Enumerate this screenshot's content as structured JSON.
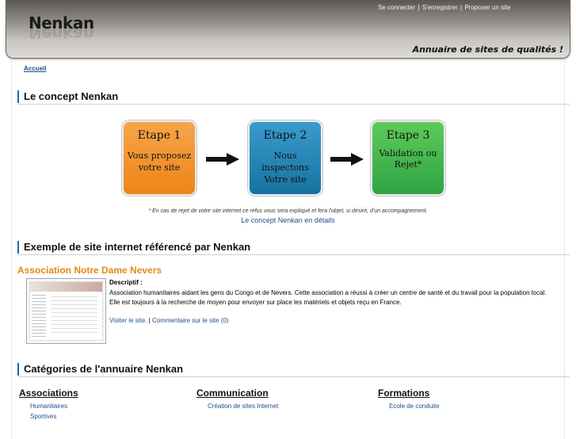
{
  "header": {
    "logo": "Nenkan",
    "tagline": "Annuaire de sites de qualités !",
    "links": {
      "login": "Se connecter",
      "register": "S'enregistrer",
      "propose": "Proposer un site",
      "separator": "|"
    }
  },
  "breadcrumb": {
    "home": "Accueil"
  },
  "concept": {
    "title": "Le concept Nenkan",
    "steps": [
      {
        "title": "Etape 1",
        "description": "Vous proposez votre site",
        "color": "#f08a1e"
      },
      {
        "title": "Etape 2",
        "description": "Nous inspectons Votre site",
        "color": "#1d7fb6"
      },
      {
        "title": "Etape 3",
        "description": "Validation ou Rejet*",
        "color": "#38b246"
      }
    ],
    "note": "* En cas de rejet de votre site internet ce refus vous sera expliqué et fera l'objet, si désiré, d'un accompagnement.",
    "details_link": "Le concept Nenkan en détails"
  },
  "example": {
    "title": "Exemple de site internet référencé par Nenkan",
    "site_name": "Association Notre Dame Nevers",
    "description_label": "Descriptif :",
    "description": "Association humanitaires aidant les gens du Congo et de Nevers. Cette association a réussi à créer un centre de santé et du travail pour la population local. Elle est toujours à la recherche de moyen pour envoyer sur place les matériels et objets reçu en France.",
    "visit_link": "Visiter le site.",
    "separator": "|",
    "comment_link": "Commentaire sur le site (0)"
  },
  "categories": {
    "title": "Catégories de l'annuaire Nenkan",
    "columns": [
      {
        "name": "Associations",
        "items": [
          "Humanitaires",
          "Sportives"
        ]
      },
      {
        "name": "Communication",
        "items": [
          "Création de sites Internet"
        ]
      },
      {
        "name": "Formations",
        "items": [
          "Ecole de conduite"
        ]
      }
    ]
  },
  "colors": {
    "accent": "#1f66a8",
    "link": "#1f4e8a",
    "site_title": "#e08a12"
  }
}
